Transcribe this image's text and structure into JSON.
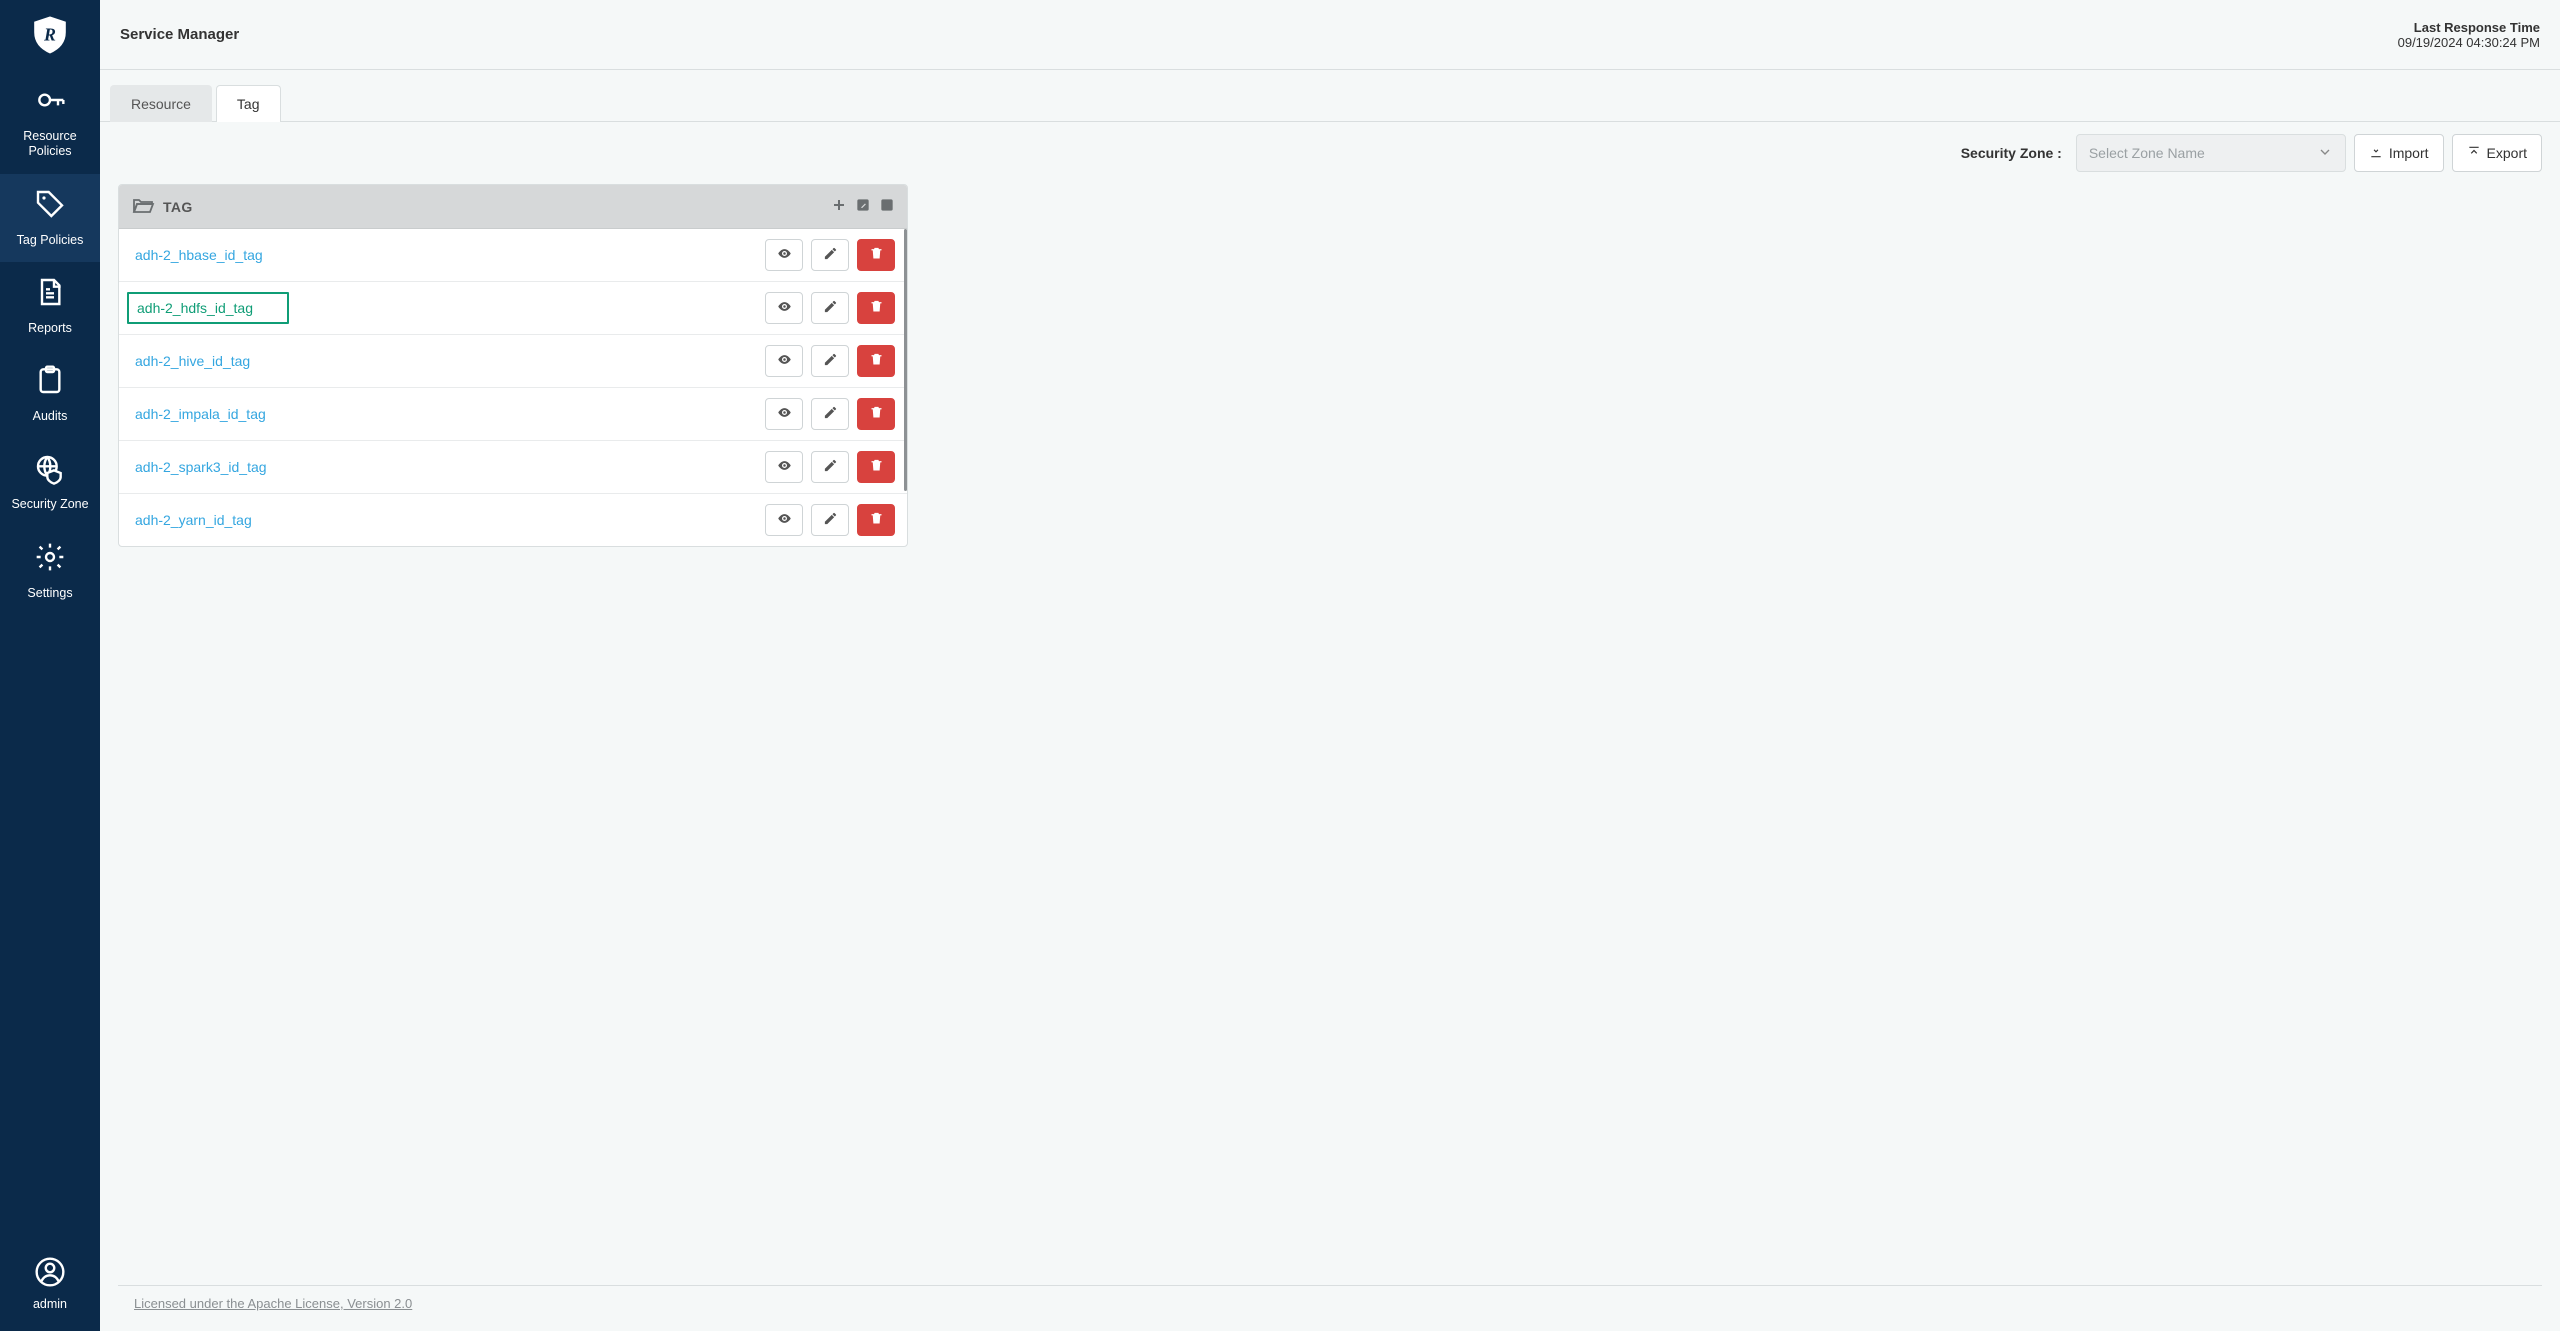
{
  "header": {
    "title": "Service Manager",
    "response_time_label": "Last Response Time",
    "response_time_value": "09/19/2024 04:30:24 PM"
  },
  "sidebar": {
    "items": [
      {
        "id": "resource-policies",
        "label": "Resource Policies"
      },
      {
        "id": "tag-policies",
        "label": "Tag Policies"
      },
      {
        "id": "reports",
        "label": "Reports"
      },
      {
        "id": "audits",
        "label": "Audits"
      },
      {
        "id": "security-zone",
        "label": "Security Zone"
      },
      {
        "id": "settings",
        "label": "Settings"
      }
    ],
    "active_index": 1,
    "user": "admin"
  },
  "tabs": {
    "items": [
      {
        "id": "resource",
        "label": "Resource"
      },
      {
        "id": "tag",
        "label": "Tag"
      }
    ],
    "active_index": 1
  },
  "toolbar": {
    "zone_label": "Security Zone :",
    "zone_placeholder": "Select Zone Name",
    "import_label": "Import",
    "export_label": "Export"
  },
  "panel": {
    "title": "TAG",
    "rows": [
      {
        "name": "adh-2_hbase_id_tag",
        "highlight": false
      },
      {
        "name": "adh-2_hdfs_id_tag",
        "highlight": true
      },
      {
        "name": "adh-2_hive_id_tag",
        "highlight": false
      },
      {
        "name": "adh-2_impala_id_tag",
        "highlight": false
      },
      {
        "name": "adh-2_spark3_id_tag",
        "highlight": false
      },
      {
        "name": "adh-2_yarn_id_tag",
        "highlight": false
      }
    ]
  },
  "footer": {
    "license": "Licensed under the Apache License, Version 2.0"
  }
}
